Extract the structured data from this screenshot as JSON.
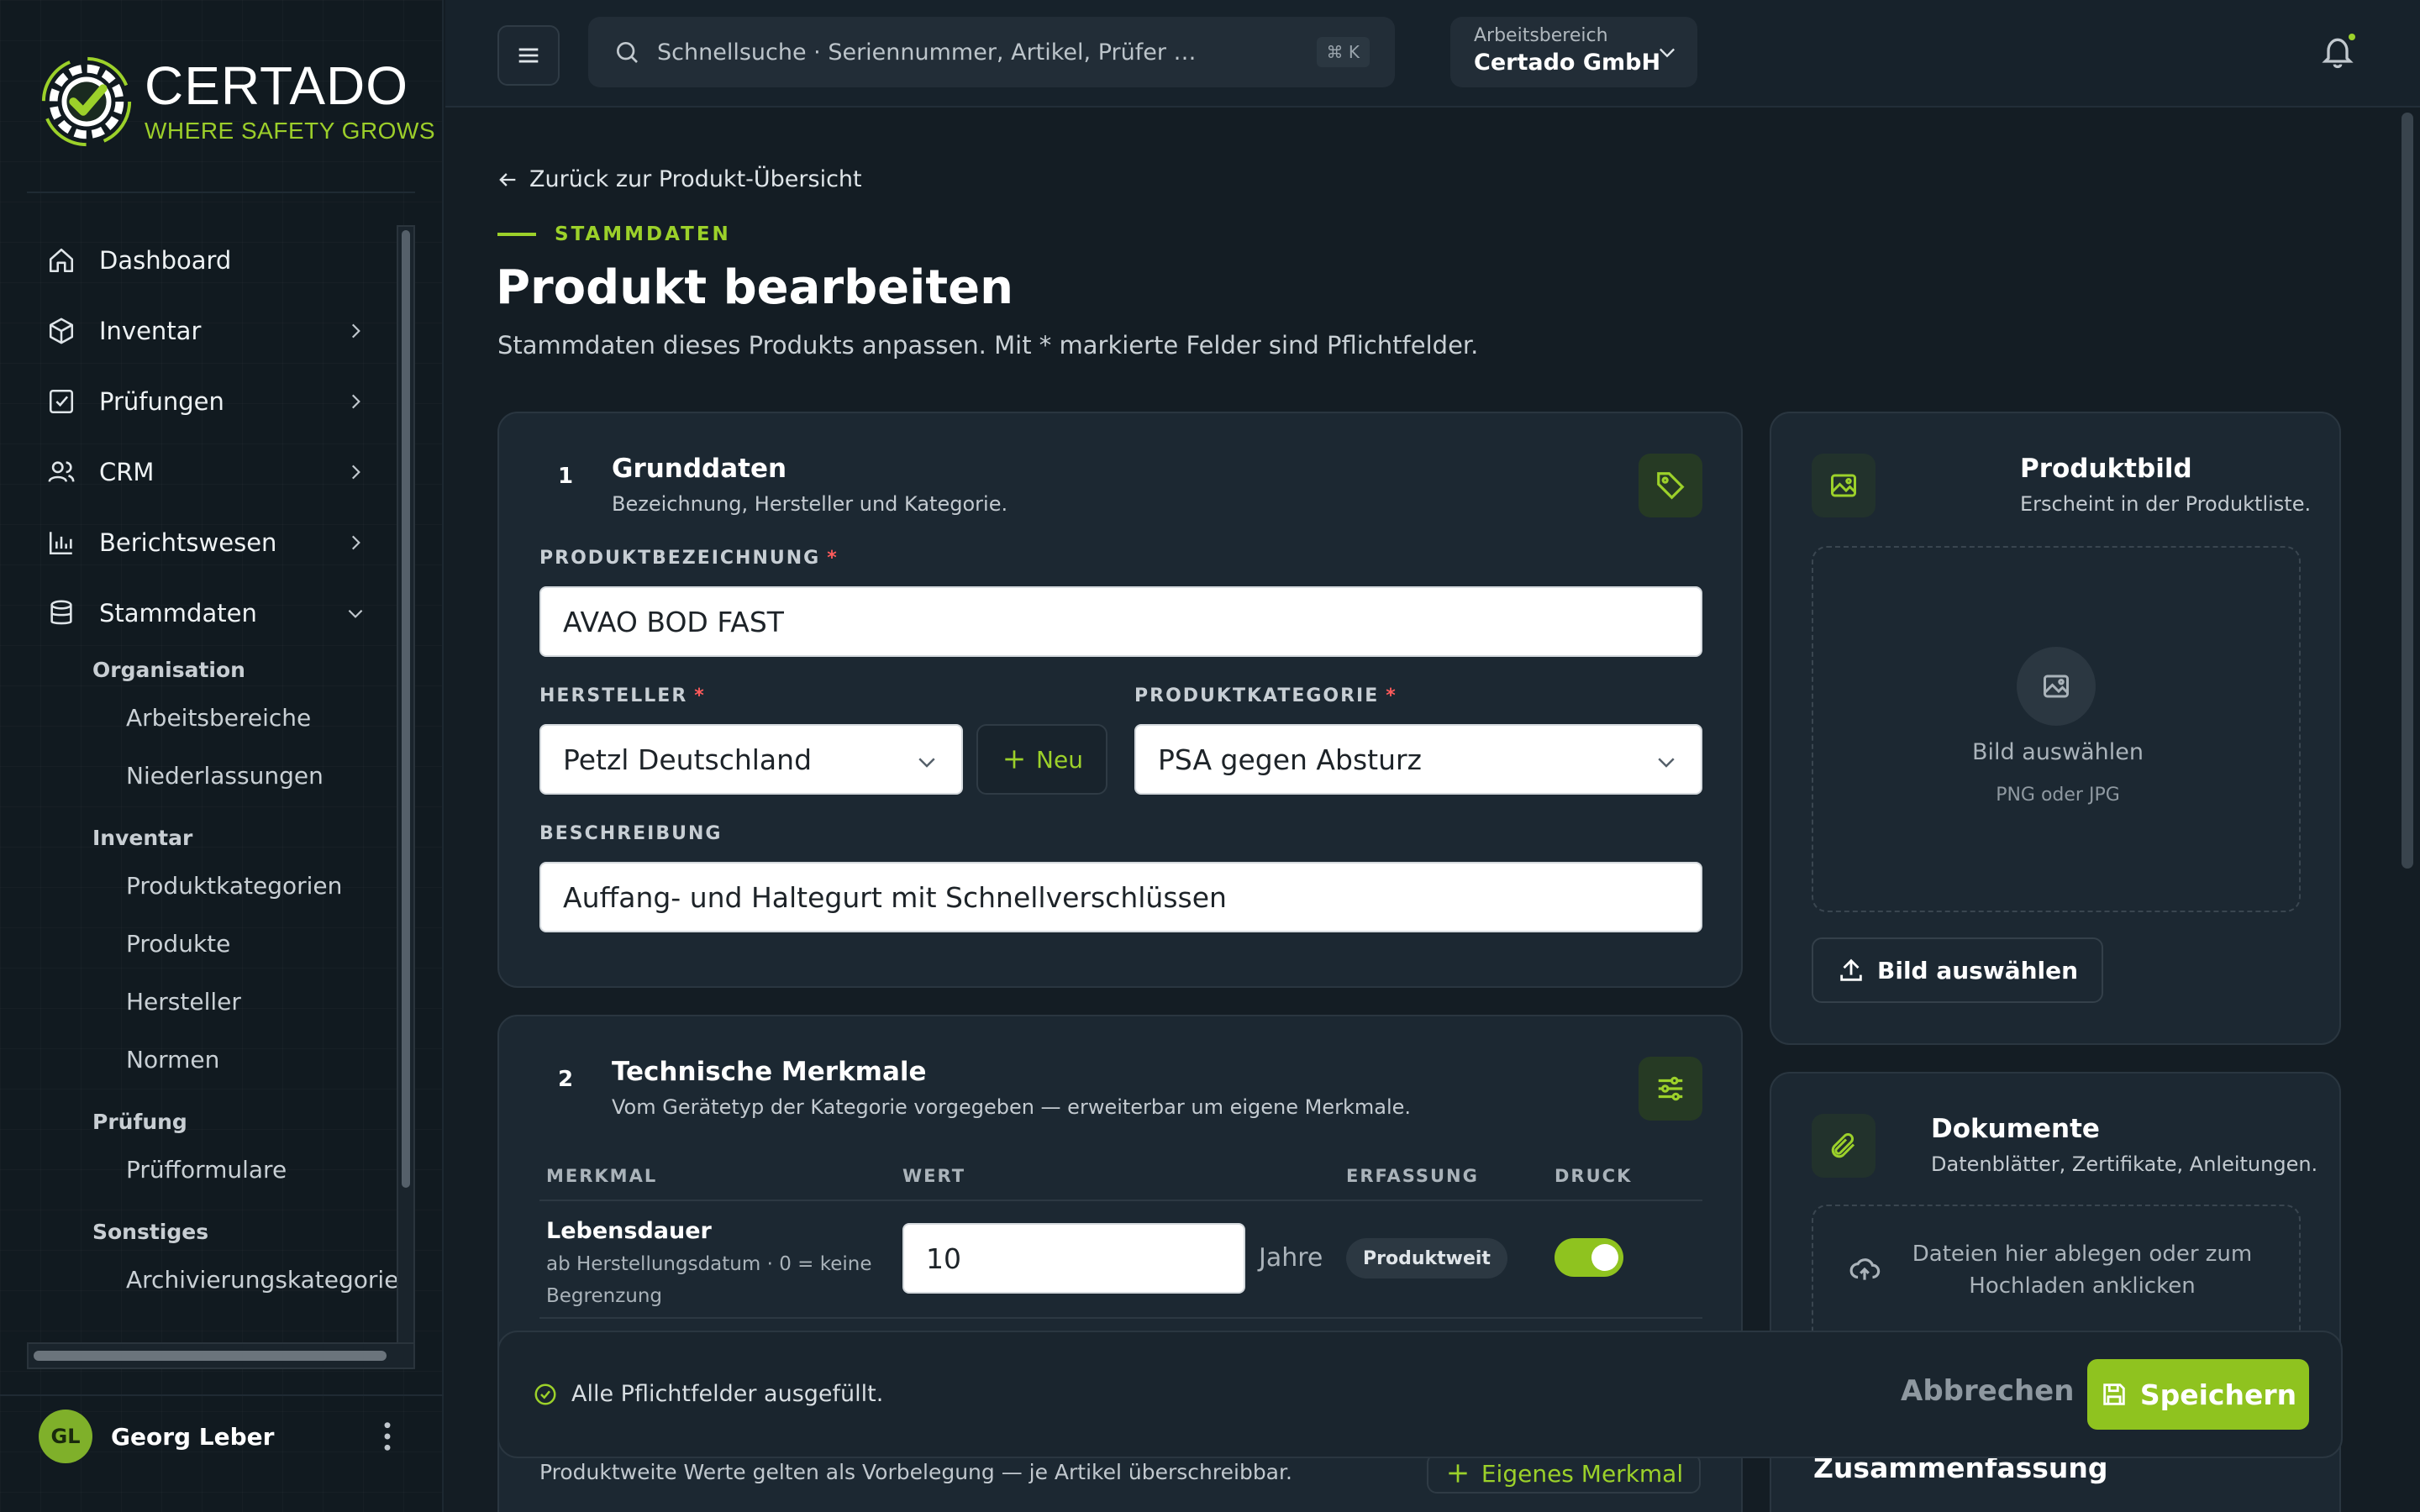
{
  "brand": {
    "name": "CERTADO",
    "tagline": "WHERE SAFETY GROWS",
    "accent": "#9cd12a"
  },
  "sidebar": {
    "items": [
      {
        "label": "Dashboard",
        "icon": "home-icon"
      },
      {
        "label": "Inventar",
        "icon": "box-icon"
      },
      {
        "label": "Prüfungen",
        "icon": "checkbox-icon"
      },
      {
        "label": "CRM",
        "icon": "users-icon"
      },
      {
        "label": "Berichtswesen",
        "icon": "bar-chart-icon"
      },
      {
        "label": "Stammdaten",
        "icon": "database-icon"
      }
    ],
    "groups": [
      {
        "label": "Organisation",
        "items": [
          "Arbeitsbereiche",
          "Niederlassungen"
        ]
      },
      {
        "label": "Inventar",
        "items": [
          "Produktkategorien",
          "Produkte",
          "Hersteller",
          "Normen"
        ]
      },
      {
        "label": "Prüfung",
        "items": [
          "Prüfformulare"
        ]
      },
      {
        "label": "Sonstiges",
        "items": [
          "Archivierungskategorien"
        ]
      }
    ],
    "user": {
      "initials": "GL",
      "name": "Georg Leber"
    }
  },
  "topbar": {
    "search_placeholder": "Schnellsuche · Seriennummer, Artikel, Prüfer …",
    "search_shortcut": "⌘ K",
    "workspace_label": "Arbeitsbereich",
    "workspace_value": "Certado GmbH"
  },
  "page": {
    "back_link": "Zurück zur Produkt-Übersicht",
    "eyebrow": "STAMMDATEN",
    "title": "Produkt bearbeiten",
    "subtitle": "Stammdaten dieses Produkts anpassen. Mit * markierte Felder sind Pflichtfelder."
  },
  "grunddaten": {
    "step": "1",
    "title": "Grunddaten",
    "subtitle": "Bezeichnung, Hersteller und Kategorie.",
    "name_label": "PRODUKTBEZEICHNUNG",
    "name_value": "AVAO BOD FAST",
    "manufacturer_label": "HERSTELLER",
    "manufacturer_value": "Petzl Deutschland",
    "new_button": "Neu",
    "category_label": "PRODUKTKATEGORIE",
    "category_value": "PSA gegen Absturz",
    "description_label": "BESCHREIBUNG",
    "description_value": "Auffang- und Haltegurt mit Schnellverschlüssen",
    "required_mark": "*"
  },
  "technik": {
    "step": "2",
    "title": "Technische Merkmale",
    "subtitle": "Vom Gerätetyp der Kategorie vorgegeben — erweiterbar um eigene Merkmale.",
    "columns": [
      "MERKMAL",
      "WERT",
      "ERFASSUNG",
      "DRUCK"
    ],
    "rows": [
      {
        "name": "Lebensdauer",
        "hint": "ab Herstellungsdatum · 0 = keine Begrenzung",
        "value": "10",
        "unit": "Jahre",
        "scope": "Produktweit",
        "print": true
      }
    ],
    "note": "Produktweite Werte gelten als Vorbelegung — je Artikel überschreibbar.",
    "own_button": "Eigenes Merkmal"
  },
  "produktbild": {
    "title": "Produktbild",
    "subtitle": "Erscheint in der Produktliste.",
    "drop_label": "Bild auswählen",
    "drop_hint": "PNG oder JPG",
    "button": "Bild auswählen"
  },
  "dokumente": {
    "title": "Dokumente",
    "subtitle": "Datenblätter, Zertifikate, Anleitungen.",
    "drop_label": "Dateien hier ablegen oder zum Hochladen anklicken"
  },
  "savebar": {
    "status": "Alle Pflichtfelder ausgefüllt.",
    "cancel": "Abbrechen",
    "save": "Speichern"
  },
  "summary_title": "Zusammenfassung"
}
